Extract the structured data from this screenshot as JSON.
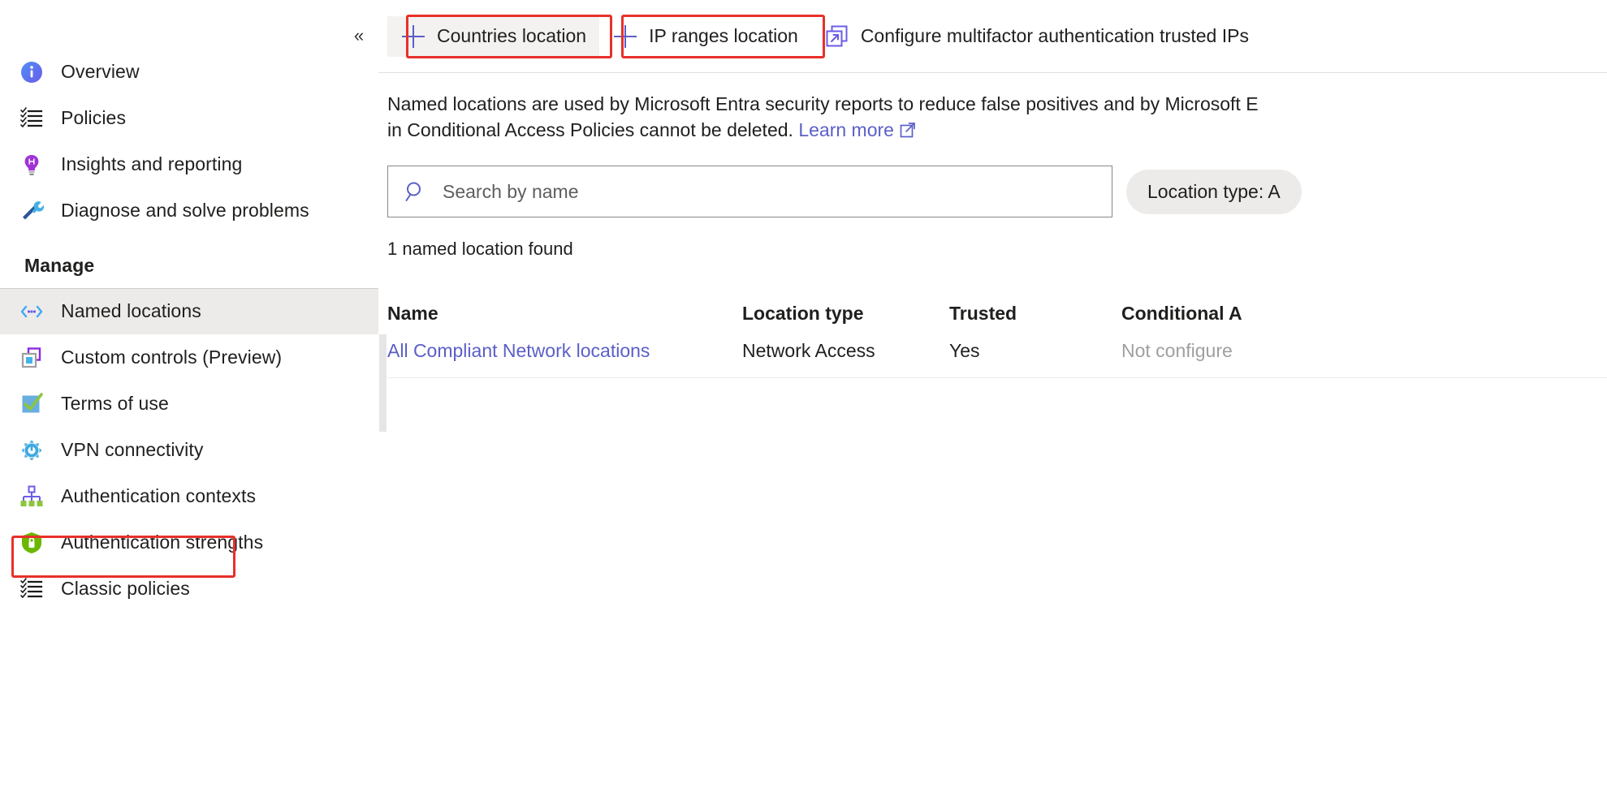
{
  "sidebar": {
    "collapse_glyph": "«",
    "items": [
      {
        "label": "Overview",
        "icon": "info-icon"
      },
      {
        "label": "Policies",
        "icon": "checklist-icon"
      },
      {
        "label": "Insights and reporting",
        "icon": "lightbulb-icon"
      },
      {
        "label": "Diagnose and solve problems",
        "icon": "wrench-screwdriver-icon"
      }
    ],
    "section_label": "Manage",
    "manage_items": [
      {
        "label": "Named locations",
        "icon": "named-locations-icon",
        "selected": true
      },
      {
        "label": "Custom controls (Preview)",
        "icon": "custom-controls-icon",
        "selected": false
      },
      {
        "label": "Terms of use",
        "icon": "terms-of-use-icon",
        "selected": false
      },
      {
        "label": "VPN connectivity",
        "icon": "vpn-gear-icon",
        "selected": false
      },
      {
        "label": "Authentication contexts",
        "icon": "auth-contexts-icon",
        "selected": false
      },
      {
        "label": "Authentication strengths",
        "icon": "shield-lock-icon",
        "selected": false
      },
      {
        "label": "Classic policies",
        "icon": "checklist-icon",
        "selected": false
      }
    ]
  },
  "toolbar": {
    "countries_location": "Countries location",
    "ip_ranges_location": "IP ranges location",
    "configure_trusted_ips": "Configure multifactor authentication trusted IPs"
  },
  "description": {
    "line1": "Named locations are used by Microsoft Entra security reports to reduce false positives and by Microsoft E",
    "line2": "in Conditional Access Policies cannot be deleted.",
    "learn_more": "Learn more"
  },
  "search": {
    "placeholder": "Search by name",
    "value": ""
  },
  "filter": {
    "location_type": "Location type: A"
  },
  "results": {
    "count_text": "1 named location found"
  },
  "table": {
    "columns": [
      "Name",
      "Location type",
      "Trusted",
      "Conditional A"
    ],
    "rows": [
      {
        "name": "All Compliant Network locations",
        "location_type": "Network Access",
        "trusted": "Yes",
        "conditional_access": "Not configure"
      }
    ]
  },
  "colors": {
    "annotation_red": "#e8302a",
    "link_blue": "#5b5fc7",
    "selected_bg": "#edebe9",
    "hover_bg": "#f3f2f1"
  }
}
